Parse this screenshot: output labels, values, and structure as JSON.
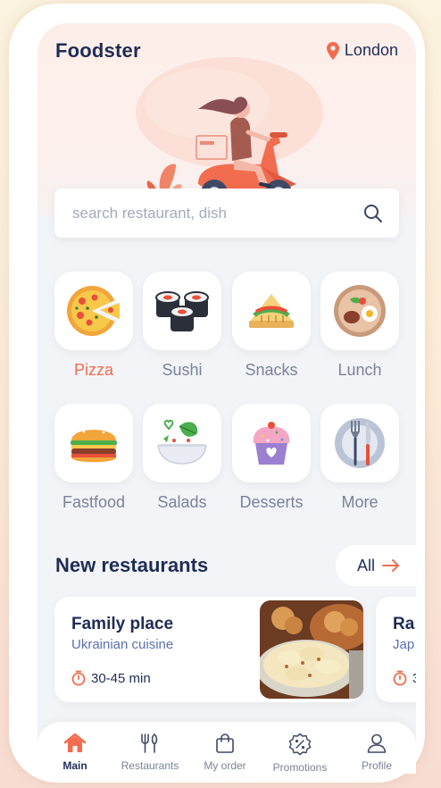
{
  "app_title": "Foodster",
  "location": {
    "city": "London",
    "icon": "location-pin-icon"
  },
  "search": {
    "placeholder": "search restaurant, dish",
    "icon": "search-icon"
  },
  "categories": [
    {
      "label": "Pizza",
      "icon": "pizza-icon",
      "active": true
    },
    {
      "label": "Sushi",
      "icon": "sushi-icon",
      "active": false
    },
    {
      "label": "Snacks",
      "icon": "sandwich-icon",
      "active": false
    },
    {
      "label": "Lunch",
      "icon": "lunch-plate-icon",
      "active": false
    },
    {
      "label": "Fastfood",
      "icon": "burger-icon",
      "active": false
    },
    {
      "label": "Salads",
      "icon": "salad-icon",
      "active": false
    },
    {
      "label": "Desserts",
      "icon": "cupcake-icon",
      "active": false
    },
    {
      "label": "More",
      "icon": "cutlery-plate-icon",
      "active": false
    }
  ],
  "new_restaurants": {
    "title": "New restaurants",
    "all_label": "All",
    "cards": [
      {
        "name": "Family place",
        "cuisine": "Ukrainian cuisine",
        "time": "30-45 min"
      },
      {
        "name": "Ra",
        "cuisine": "Jap",
        "time": "3"
      }
    ]
  },
  "nav": [
    {
      "label": "Main",
      "icon": "home-icon",
      "active": true
    },
    {
      "label": "Restaurants",
      "icon": "fork-knife-icon",
      "active": false
    },
    {
      "label": "My order",
      "icon": "shopping-bag-icon",
      "active": false
    },
    {
      "label": "Promotions",
      "icon": "percent-badge-icon",
      "active": false
    },
    {
      "label": "Profile",
      "icon": "user-icon",
      "active": false
    }
  ],
  "colors": {
    "accent": "#f26c4f",
    "title": "#1f2d55",
    "muted": "#7a8298",
    "background": "#f3f4f8"
  }
}
